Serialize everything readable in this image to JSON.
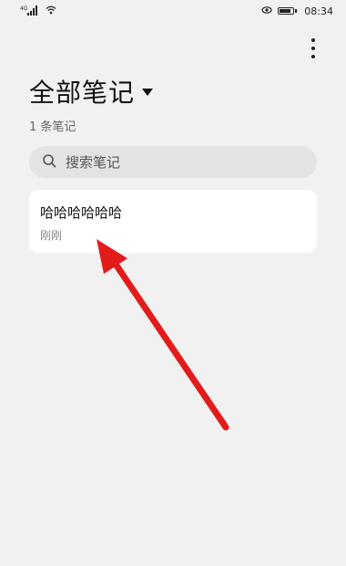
{
  "status_bar": {
    "network_label": "4G",
    "time": "08:34",
    "icons": [
      "signal-icon",
      "wifi-icon",
      "eye-comfort-icon",
      "battery-icon"
    ]
  },
  "header": {
    "title": "全部笔记",
    "count": "1 条笔记"
  },
  "search": {
    "placeholder": "搜索笔记"
  },
  "notes": [
    {
      "title": "哈哈哈哈哈哈",
      "time": "刚刚"
    }
  ],
  "colors": {
    "background": "#f1f1f1",
    "card": "#ffffff",
    "search_bg": "#e3e3e3",
    "annotation_arrow": "#e21b1b"
  }
}
